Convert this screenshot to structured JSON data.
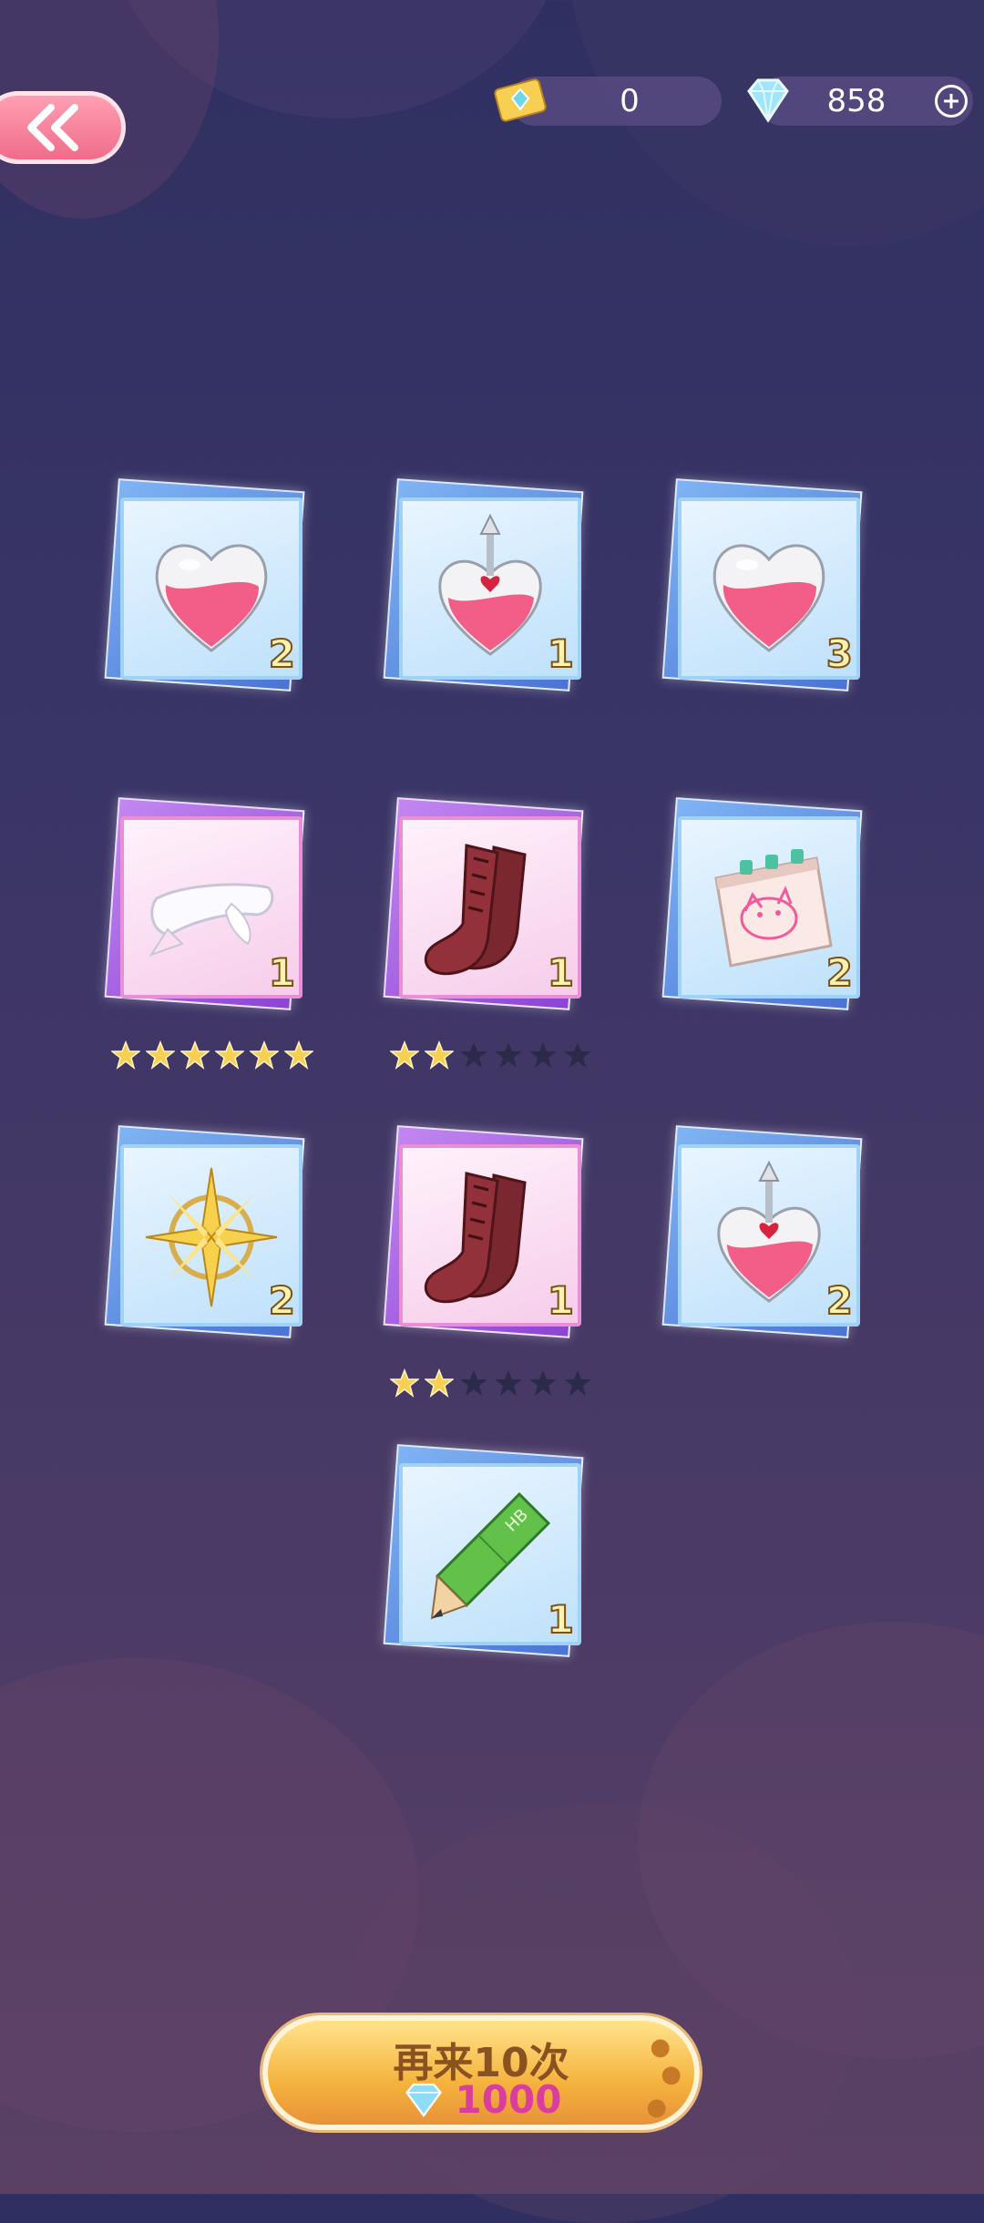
{
  "header": {
    "ticket_count": "0",
    "diamond_count": "858"
  },
  "items": [
    {
      "name": "heart-potion",
      "count": "2",
      "rarity": "blue"
    },
    {
      "name": "heart-potion-arrow",
      "count": "1",
      "rarity": "blue"
    },
    {
      "name": "heart-potion",
      "count": "3",
      "rarity": "blue"
    },
    {
      "name": "white-scarf",
      "count": "1",
      "rarity": "pink",
      "stars": 6,
      "max_stars": 6
    },
    {
      "name": "red-socks",
      "count": "1",
      "rarity": "pink",
      "stars": 2,
      "max_stars": 6
    },
    {
      "name": "cat-notepad",
      "count": "2",
      "rarity": "blue"
    },
    {
      "name": "gold-compass-star",
      "count": "2",
      "rarity": "blue"
    },
    {
      "name": "red-socks",
      "count": "1",
      "rarity": "pink",
      "stars": 2,
      "max_stars": 6
    },
    {
      "name": "heart-potion-arrow",
      "count": "2",
      "rarity": "blue"
    },
    {
      "name": "green-pencil",
      "count": "1",
      "rarity": "blue"
    }
  ],
  "footer": {
    "again_label": "再来10次",
    "again_cost": "1000"
  },
  "colors": {
    "accent_pink": "#f06c8a",
    "button_gold": "#f5b33d",
    "cost_text": "#d93e9d"
  }
}
